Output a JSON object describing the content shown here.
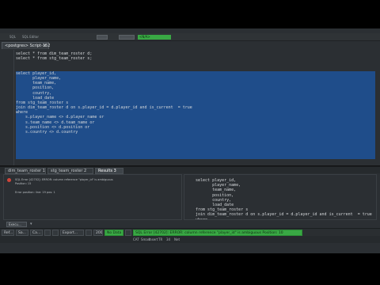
{
  "toolbar": {
    "items": [
      "SQL",
      "SQL Editor",
      "Commit",
      "Rollback"
    ],
    "green_label": "<N/A>"
  },
  "editor_tab": {
    "title": "<postgres> Script-152",
    "close": "×"
  },
  "editor": {
    "lines": [
      "select * from dim_team_roster d;",
      "select * from stg_team_roster s;",
      "",
      "",
      "select player_id,",
      "       player_name,",
      "       team_name,",
      "       position,",
      "       country,",
      "       load_date",
      "from stg_team_roster s",
      "join dim_team_roster d on s.player_id = d.player_id and is_current  = true",
      "where",
      "    s.player_name <> d.player_name or",
      "    s.team_name <> d.team_name or",
      "    s.position <> d.position or",
      "    s.country <> d.country"
    ]
  },
  "results_tabs": [
    {
      "label": "dim_team_roster 1",
      "active": false
    },
    {
      "label": "stg_team_roster 2",
      "active": false
    },
    {
      "label": "Results 3",
      "active": true
    }
  ],
  "results": {
    "error_lines": [
      "SQL Error [42702]: ERROR: column reference \"player_id\" is ambiguous",
      "Position: 15",
      "",
      "Error position: line: 19 pos: 1"
    ],
    "query_lines": [
      "select player_id,",
      "       player_name,",
      "       team_name,",
      "       position,",
      "       country,",
      "       load_date",
      "from stg_team_roster s",
      "join dim_team_roster d on s.player_id = d.player_id and is_current  = true",
      "where"
    ],
    "execlog_label": "Execu..."
  },
  "taskbar": {
    "items": [
      {
        "label": "Ref...",
        "green": false
      },
      {
        "label": "Sa...",
        "green": false
      },
      {
        "label": "Ca...",
        "green": false
      },
      {
        "label": "",
        "green": false
      },
      {
        "label": "",
        "green": false
      },
      {
        "label": "Export...",
        "green": false
      },
      {
        "label": "",
        "green": false
      },
      {
        "label": "200",
        "green": false
      },
      {
        "label": "No Data",
        "green": true
      },
      {
        "label": "",
        "green": false
      },
      {
        "label": "SQL Error [42702]: ERROR: column reference \"player_id\" is ambiguous  Position: 10",
        "green": true
      }
    ]
  },
  "status": {
    "items": [
      "CAT",
      "Smart",
      "Insert",
      "TR",
      "34",
      "Net"
    ]
  }
}
